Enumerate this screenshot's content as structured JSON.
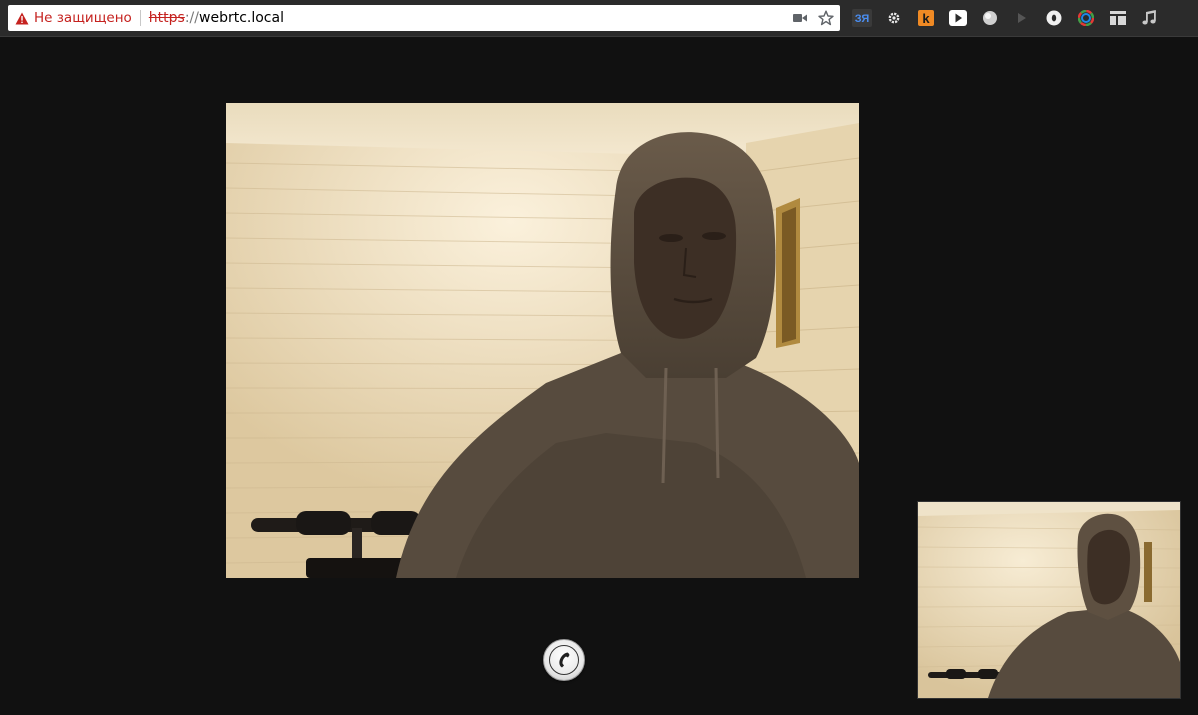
{
  "browser": {
    "security_text": "Не защищено",
    "url_scheme": "https",
    "url_separator": "://",
    "url_host": "webrtc.local",
    "icons": [
      "warning-icon",
      "camera-icon",
      "star-icon"
    ],
    "extensions": [
      "translate-extension-icon",
      "settings-extension-icon",
      "k-extension-icon",
      "play-extension-icon",
      "globe-extension-icon",
      "forward-extension-icon",
      "circle-extension-icon",
      "color-wheel-extension-icon",
      "layout-extension-icon",
      "music-extension-icon"
    ],
    "extension_k_label": "k",
    "extension_translate_label": "ЗЯ"
  },
  "page": {
    "remote_video": "remote-video",
    "local_video": "local-video",
    "call_button_icon": "phone-icon"
  },
  "colors": {
    "background": "#111111",
    "warning": "#c5221f",
    "toolbar": "#2b2b2b"
  }
}
